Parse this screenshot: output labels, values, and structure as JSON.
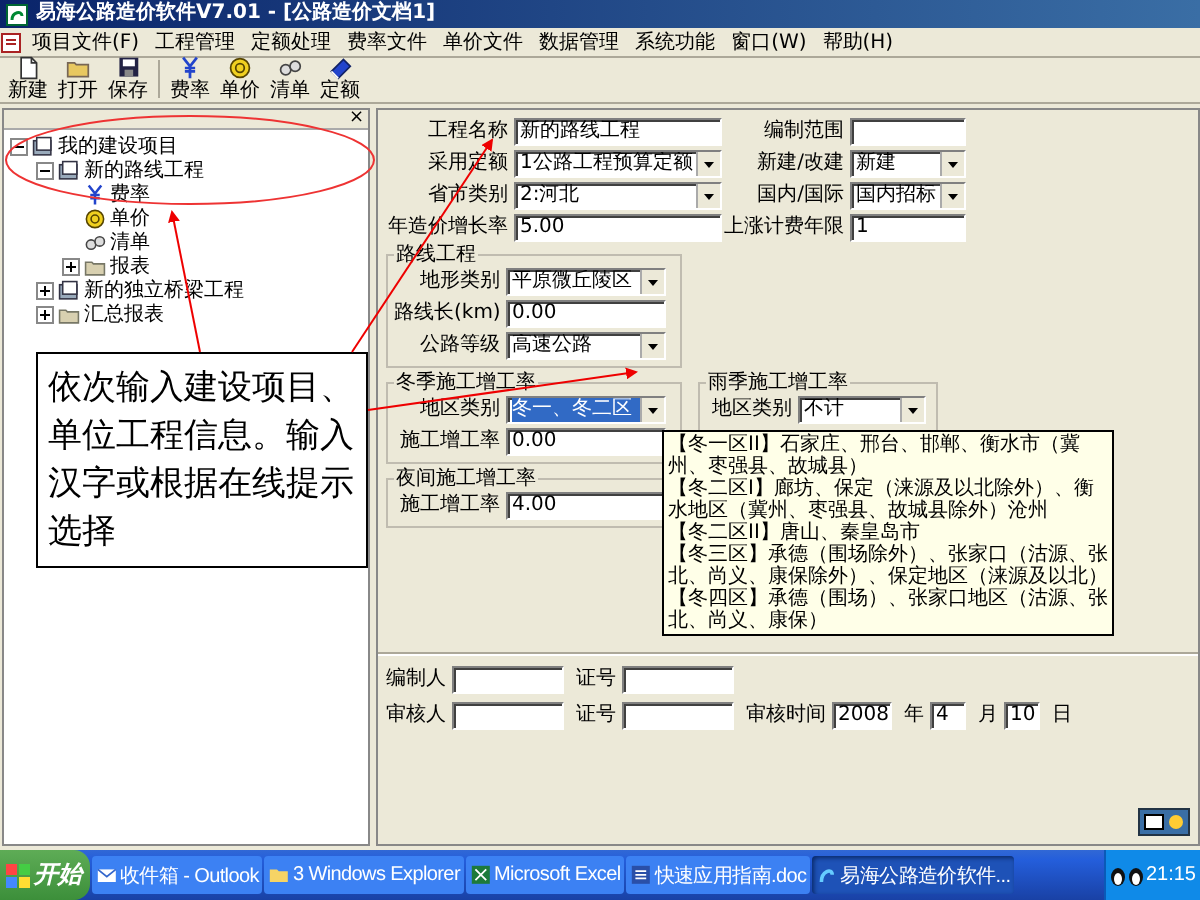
{
  "window": {
    "title": "易海公路造价软件V7.01 - [公路造价文档1]"
  },
  "menu": [
    "项目文件(F)",
    "工程管理",
    "定额处理",
    "费率文件",
    "单价文件",
    "数据管理",
    "系统功能",
    "窗口(W)",
    "帮助(H)"
  ],
  "toolbar": [
    {
      "label": "新建",
      "kind": "new"
    },
    {
      "label": "打开",
      "kind": "open"
    },
    {
      "label": "保存",
      "kind": "save"
    },
    {
      "label": "费率",
      "kind": "rate"
    },
    {
      "label": "单价",
      "kind": "price"
    },
    {
      "label": "清单",
      "kind": "list"
    },
    {
      "label": "定额",
      "kind": "quota"
    }
  ],
  "tree_pane": {
    "close": "×",
    "items": [
      {
        "label": "我的建设项目",
        "kind": "project",
        "expanded": true,
        "children": [
          {
            "label": "新的路线工程",
            "kind": "project",
            "expanded": true,
            "children": [
              {
                "label": "费率",
                "kind": "rate"
              },
              {
                "label": "单价",
                "kind": "price"
              },
              {
                "label": "清单",
                "kind": "list"
              },
              {
                "label": "报表",
                "kind": "folder",
                "expanded": false
              }
            ]
          },
          {
            "label": "新的独立桥梁工程",
            "kind": "project",
            "expanded": false
          },
          {
            "label": "汇总报表",
            "kind": "folder",
            "expanded": false
          }
        ]
      }
    ]
  },
  "form": {
    "main_fields": [
      {
        "label": "工程名称",
        "kind": "text",
        "value": "新的路线工程"
      },
      {
        "label": "编制范围",
        "kind": "text"
      },
      {
        "label": "采用定额",
        "kind": "select",
        "value": "1公路工程预算定额",
        "focused": false
      },
      {
        "label": "新建/改建",
        "kind": "select",
        "value": "新建",
        "focused": false
      },
      {
        "label": "省市类别",
        "kind": "select",
        "value": "2:河北",
        "focused": false
      },
      {
        "label": "国内/国际",
        "kind": "select",
        "value": "国内招标",
        "focused": false
      },
      {
        "label": "年造价增长率",
        "kind": "text",
        "value": "5.00"
      },
      {
        "label": "上涨计费年限",
        "kind": "text",
        "value": "1"
      }
    ],
    "groups": [
      {
        "title": "路线工程",
        "fields": [
          {
            "label": "地形类别",
            "kind": "select",
            "value": "平原微丘陵区",
            "focused": false
          },
          {
            "label": "路线长(km)",
            "kind": "text",
            "value": "0.00"
          },
          {
            "label": "公路等级",
            "kind": "select",
            "value": "高速公路",
            "focused": false
          }
        ]
      },
      {
        "title": "冬季施工增工率",
        "fields": [
          {
            "label": "地区类别",
            "kind": "select",
            "value": "冬一、冬二区",
            "focused": true
          },
          {
            "label": "施工增工率",
            "kind": "text",
            "value": "0.00"
          }
        ]
      },
      {
        "title": "夜间施工增工率",
        "fields": [
          {
            "label": "施工增工率",
            "kind": "text",
            "value": "4.00"
          }
        ]
      }
    ],
    "side_group": {
      "title": "雨季施工增工率",
      "fields": [
        {
          "label": "地区类别",
          "kind": "select",
          "value": "不计",
          "focused": false
        }
      ]
    },
    "signoff": [
      [
        {
          "kind": "label",
          "text": "编制人"
        },
        {
          "kind": "field"
        },
        {
          "kind": "label",
          "text": "证号"
        },
        {
          "kind": "field"
        }
      ],
      [
        {
          "kind": "label",
          "text": "审核人"
        },
        {
          "kind": "field"
        },
        {
          "kind": "label",
          "text": "证号"
        },
        {
          "kind": "field"
        },
        {
          "kind": "label",
          "text": "审核时间"
        },
        {
          "kind": "date-field",
          "value": "2008"
        },
        {
          "kind": "label",
          "text": "年"
        },
        {
          "kind": "date-field",
          "value": "4"
        },
        {
          "kind": "label",
          "text": "月"
        },
        {
          "kind": "date-field",
          "value": "10"
        },
        {
          "kind": "label",
          "text": "日"
        }
      ]
    ]
  },
  "dropdown_list": {
    "options": [
      "【冬一区II】石家庄、邢台、邯郸、衡水市（冀州、枣强县、故城县）",
      "【冬二区I】廊坊、保定（涞源及以北除外）、衡水地区（冀州、枣强县、故城县除外）沧州",
      "【冬二区II】唐山、秦皇岛市",
      "【冬三区】承德（围场除外）、张家口（沽源、张北、尚义、康保除外）、保定地区（涞源及以北）",
      "【冬四区】承德（围场）、张家口地区（沽源、张北、尚义、康保）"
    ]
  },
  "callout": {
    "text": "依次输入建设项目、单位工程信息。输入汉字或根据在线提示选择"
  },
  "taskbar": {
    "start": "开始",
    "tasks": [
      {
        "label": "收件箱 - Outlook",
        "kind": "mail",
        "selected": false
      },
      {
        "label": "3 Windows Explorer",
        "kind": "folder",
        "selected": false
      },
      {
        "label": "Microsoft Excel",
        "kind": "sheet",
        "selected": false
      },
      {
        "label": "快速应用指南.doc",
        "kind": "doc",
        "selected": false
      },
      {
        "label": "易海公路造价软件...",
        "kind": "app",
        "selected": true
      }
    ],
    "clock": "21:15"
  }
}
